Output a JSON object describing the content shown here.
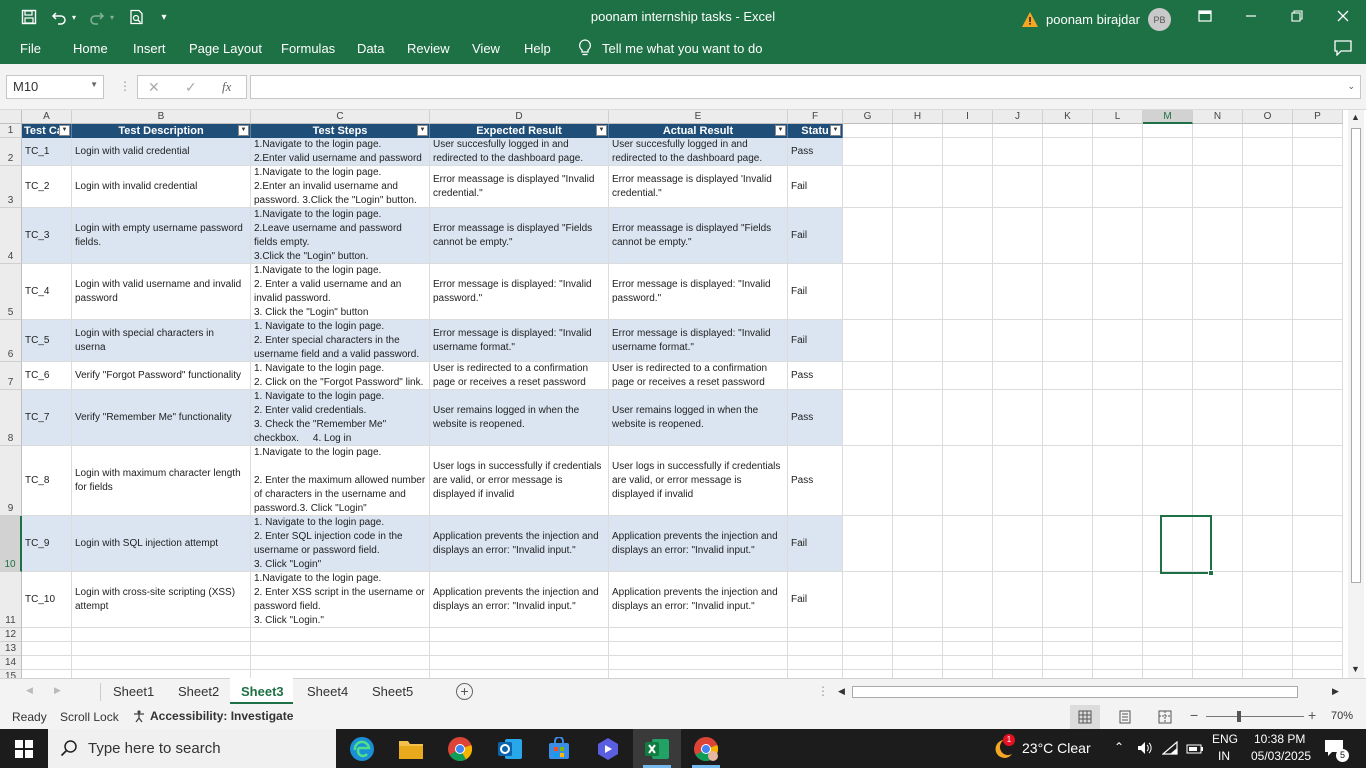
{
  "title_bar": {
    "title": "poonam internship tasks  -  Excel",
    "user_name": "poonam birajdar",
    "avatar_initials": "PB"
  },
  "ribbon": {
    "tabs": [
      "File",
      "Home",
      "Insert",
      "Page Layout",
      "Formulas",
      "Data",
      "Review",
      "View",
      "Help"
    ],
    "tell_me": "Tell me what you want to do"
  },
  "formula_bar": {
    "name_box": "M10",
    "formula": ""
  },
  "columns": [
    "A",
    "B",
    "C",
    "D",
    "E",
    "F",
    "G",
    "H",
    "I",
    "J",
    "K",
    "L",
    "M",
    "N",
    "O",
    "P"
  ],
  "rows": [
    "1",
    "2",
    "3",
    "4",
    "5",
    "6",
    "7",
    "8",
    "9",
    "10",
    "11",
    "12",
    "13",
    "14",
    "15"
  ],
  "table": {
    "headers": [
      "Test Cas",
      "Test Description",
      "Test Steps",
      "Expected Result",
      "Actual Result",
      "Statu"
    ],
    "rows": [
      [
        "TC_1",
        "Login with valid credential",
        "1.Navigate to the login page.\n2.Enter valid username and password",
        "User succesfully logged in and redirected to the dashboard page.",
        "User succesfully logged in and redirected to the dashboard page.",
        "Pass"
      ],
      [
        "TC_2",
        "Login with invalid credential",
        "1.Navigate to the login page.\n2.Enter an invalid username and password. 3.Click the \"Login\" button.",
        "Error meassage is displayed \"Invalid credential.\"",
        "Error meassage is displayed 'Invalid credential.\"",
        "Fail"
      ],
      [
        "TC_3",
        "Login with empty username password fields.",
        "1.Navigate to the login page.\n2.Leave username and password fields empty.\n3.Click the \"Login\" button.",
        "Error meassage is displayed \"Fields cannot be empty.\"",
        "Error meassage is displayed \"Fields cannot be empty.\"",
        "Fail"
      ],
      [
        "TC_4",
        "Login with valid username and invalid password",
        "1.Navigate to the login page.\n2. Enter a valid username and an invalid password.\n3. Click the \"Login\" button",
        "Error message is displayed: \"Invalid password.\"",
        "Error message is displayed: \"Invalid password.\"",
        "Fail"
      ],
      [
        "TC_5",
        "Login with special characters in userna",
        "1. Navigate to the login page.\n2. Enter special characters in the username field and a valid password.",
        "Error message is displayed: \"Invalid username format.\"",
        "Error message is displayed: \"Invalid username format.\"",
        "Fail"
      ],
      [
        "TC_6",
        "Verify \"Forgot Password\" functionality",
        "1. Navigate to the login page.\n2. Click on the \"Forgot Password\" link.",
        "User is redirected to a confirmation page or receives a reset password",
        "User is redirected to a confirmation page or receives a reset password",
        "Pass"
      ],
      [
        "TC_7",
        "Verify \"Remember Me\" functionality",
        "1. Navigate to the login page.\n2. Enter valid credentials.\n3. Check the \"Remember Me\" checkbox.     4. Log in",
        "User remains logged in when the website is reopened.",
        "User remains logged in when the website is reopened.",
        "Pass"
      ],
      [
        "TC_8",
        "Login with maximum character length for fields",
        "1.Navigate to the login page.\n\n2. Enter the maximum allowed number of characters in the username and password.3. Click \"Login\"",
        "User logs in successfully if credentials are valid, or error message is displayed if invalid",
        "User logs in successfully if credentials are valid, or error message is displayed if invalid",
        "Pass"
      ],
      [
        "TC_9",
        "Login with SQL injection attempt",
        "1. Navigate to the login page.\n2. Enter SQL injection code in the username or password field.\n3. Click \"Login\"",
        "Application prevents the injection and displays an error: \"Invalid input.\"",
        "Application prevents the injection and displays an error: \"Invalid input.\"",
        "Fail"
      ],
      [
        "TC_10",
        "Login with cross-site scripting (XSS) attempt",
        "1.Navigate to the login page.\n2. Enter XSS script in the username or password field.\n3. Click \"Login.\"",
        "Application prevents the injection and displays an error: \"Invalid input.\"",
        "Application prevents the injection and displays an error: \"Invalid input.\"",
        "Fail"
      ]
    ]
  },
  "sheet_tabs": [
    "Sheet1",
    "Sheet2",
    "Sheet3",
    "Sheet4",
    "Sheet5"
  ],
  "active_sheet": "Sheet3",
  "status_bar": {
    "ready": "Ready",
    "scroll_lock": "Scroll Lock",
    "accessibility": "Accessibility: Investigate",
    "zoom": "70%"
  },
  "taskbar": {
    "search_placeholder": "Type here to search",
    "weather": "23°C  Clear",
    "weather_badge": "1",
    "lang1": "ENG",
    "lang2": "IN",
    "time": "10:38 PM",
    "date": "05/03/2025",
    "notif_count": "5"
  },
  "colors": {
    "excel_green": "#1e7145",
    "header_blue": "#1f4e79",
    "band_blue": "#dbe5f1"
  }
}
